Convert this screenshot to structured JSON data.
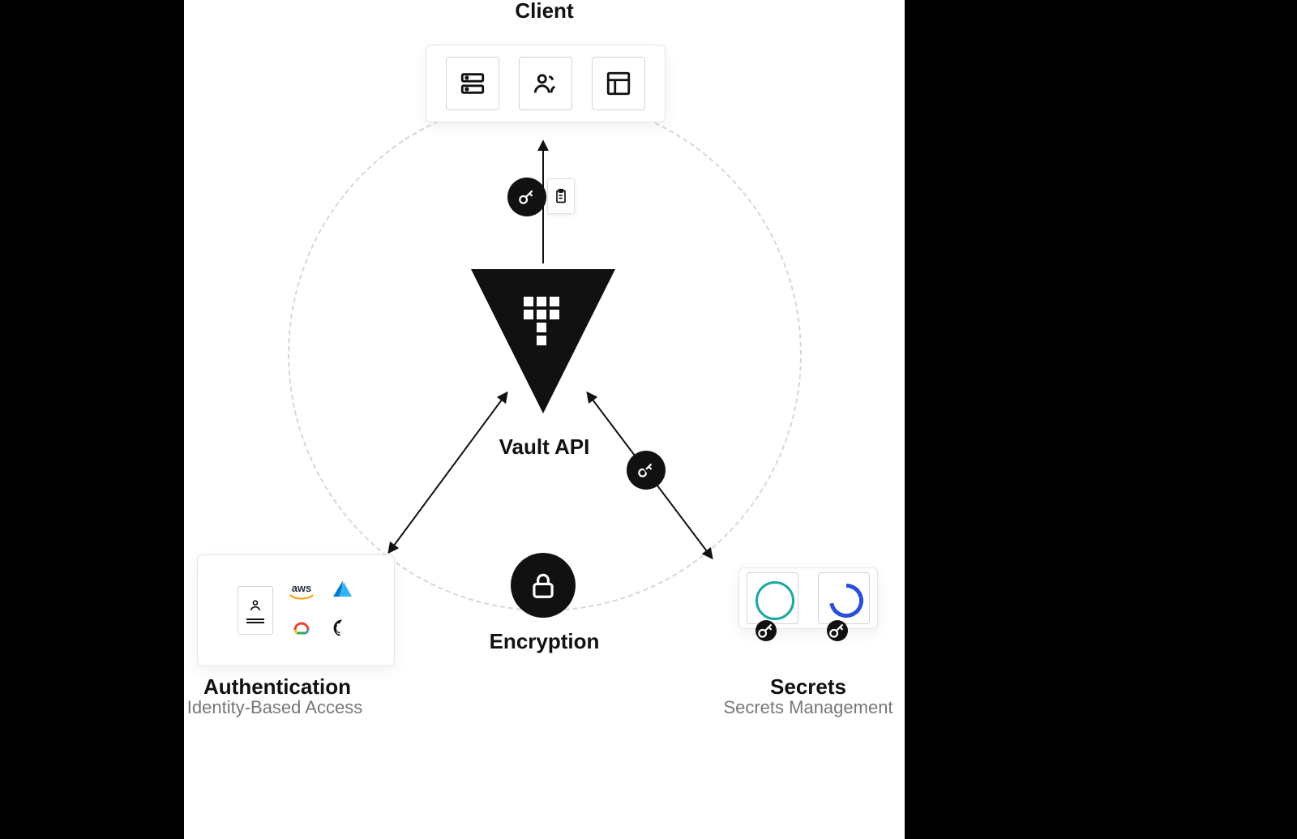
{
  "top": {
    "title": "Client",
    "icons": [
      "server-icon",
      "users-icon",
      "layout-icon"
    ]
  },
  "center": {
    "label": "Vault API"
  },
  "encryption": {
    "label": "Encryption"
  },
  "authentication": {
    "title": "Authentication",
    "subtitle": "Identity-Based Access",
    "providers": [
      "aws",
      "azure",
      "google-cloud",
      "github"
    ]
  },
  "secrets": {
    "title": "Secrets",
    "subtitle": "Secrets Management"
  },
  "badges": {
    "key_clipboard": [
      "key-icon",
      "clipboard-icon"
    ],
    "right_key": "key-icon"
  },
  "colors": {
    "ink": "#111111",
    "muted": "#777777",
    "teal_ring": "#1aa9a0",
    "blue_ring": "#2b4fd9"
  }
}
